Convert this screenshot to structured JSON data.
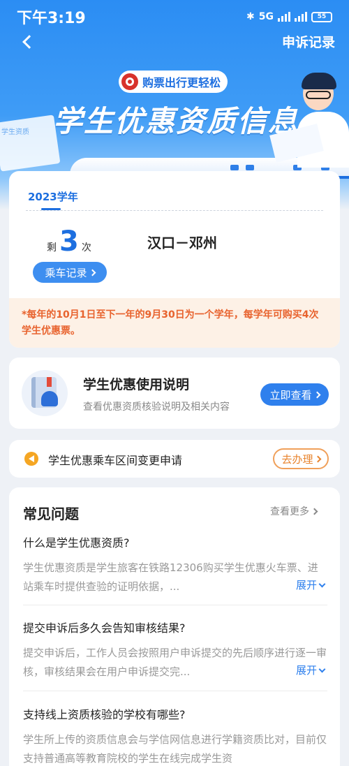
{
  "status_bar": {
    "time": "下午3:19",
    "bluetooth_icon": "bluetooth-icon",
    "network": "5G",
    "battery": "55"
  },
  "nav": {
    "back_icon": "chevron-left-icon",
    "right_link": "申诉记录"
  },
  "hero": {
    "badge_text": "购票出行更轻松",
    "title": "学生优惠资质信息",
    "paper_text": "学生资质"
  },
  "quota": {
    "year_tab": "2023学年",
    "remain_prefix": "剩",
    "remain_count": "3",
    "remain_suffix": "次",
    "route": "汉口－邓州",
    "rides_button": "乘车记录",
    "notice": "*每年的10月1日至下一年的9月30日为一个学年，每学年可购买4次学生优惠票。"
  },
  "guide": {
    "title": "学生优惠使用说明",
    "subtitle": "查看优惠资质核验说明及相关内容",
    "button": "立即查看"
  },
  "change_request": {
    "icon": "megaphone-icon",
    "text": "学生优惠乘车区间变更申请",
    "button": "去办理"
  },
  "faq": {
    "heading": "常见问题",
    "more": "查看更多",
    "items": [
      {
        "question": "什么是学生优惠资质?",
        "answer": "学生优惠资质是学生旅客在铁路12306购买学生优惠火车票、进站乘车时提供查验的证明依据，...",
        "expand": "展开"
      },
      {
        "question": "提交申诉后多久会告知审核结果?",
        "answer": "提交申诉后，工作人员会按照用户申诉提交的先后顺序进行逐一审核，审核结果会在用户申诉提交完...",
        "expand": "展开"
      },
      {
        "question": "支持线上资质核验的学校有哪些?",
        "answer": "学生所上传的资质信息会与学信网信息进行学籍资质比对，目前仅支持普通高等教育院校的学生在线完成学生资",
        "expand": ""
      }
    ]
  },
  "colors": {
    "primary": "#2f80ed",
    "notice_text": "#e8632e",
    "notice_bg": "#fdf1e6",
    "orange_button": "#e8842e"
  }
}
